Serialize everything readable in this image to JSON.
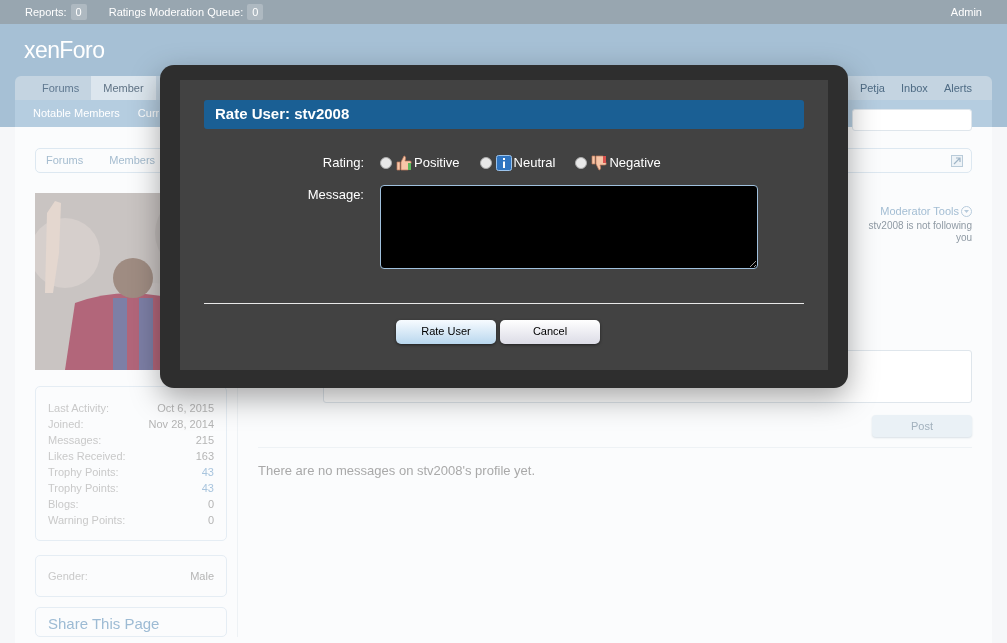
{
  "top_bar": {
    "reports_label": "Reports:",
    "reports_count": "0",
    "queue_label": "Ratings Moderation Queue:",
    "queue_count": "0",
    "user": "Admin"
  },
  "logo": "xenForo",
  "nav_tabs": [
    {
      "label": "Forums",
      "selected": false
    },
    {
      "label": "Member",
      "selected": true
    }
  ],
  "nav_right": [
    "Petja",
    "Inbox",
    "Alerts"
  ],
  "sub_nav": [
    "Notable Members",
    "Curr"
  ],
  "breadcrumb": [
    "Forums",
    "Members"
  ],
  "profile": {
    "moderator_tools": "Moderator Tools",
    "follow_status": "stv2008 is not following you"
  },
  "stats": [
    {
      "label": "Last Activity:",
      "value": "Oct 6, 2015",
      "kind": "plain"
    },
    {
      "label": "Joined:",
      "value": "Nov 28, 2014",
      "kind": "plain"
    },
    {
      "label": "Messages:",
      "value": "215",
      "kind": "plain"
    },
    {
      "label": "Likes Received:",
      "value": "163",
      "kind": "plain"
    },
    {
      "label": "Trophy Points:",
      "value": "43",
      "kind": "link"
    },
    {
      "label": "Trophy Points:",
      "value": "43",
      "kind": "link"
    },
    {
      "label": "Blogs:",
      "value": "0",
      "kind": "plain"
    },
    {
      "label": "Warning Points:",
      "value": "0",
      "kind": "plain"
    }
  ],
  "gender": {
    "label": "Gender:",
    "value": "Male"
  },
  "share_title": "Share This Page",
  "post_button": "Post",
  "empty_message": "There are no messages on stv2008's profile yet.",
  "dialog": {
    "title": "Rate User: stv2008",
    "rating_label": "Rating:",
    "options": [
      {
        "label": "Positive",
        "kind": "positive",
        "selected": false
      },
      {
        "label": "Neutral",
        "kind": "neutral",
        "selected": false
      },
      {
        "label": "Negative",
        "kind": "negative",
        "selected": false
      }
    ],
    "message_label": "Message:",
    "buttons": [
      {
        "label": "Rate User",
        "kind": "primary"
      },
      {
        "label": "Cancel",
        "kind": "secondary"
      }
    ]
  }
}
